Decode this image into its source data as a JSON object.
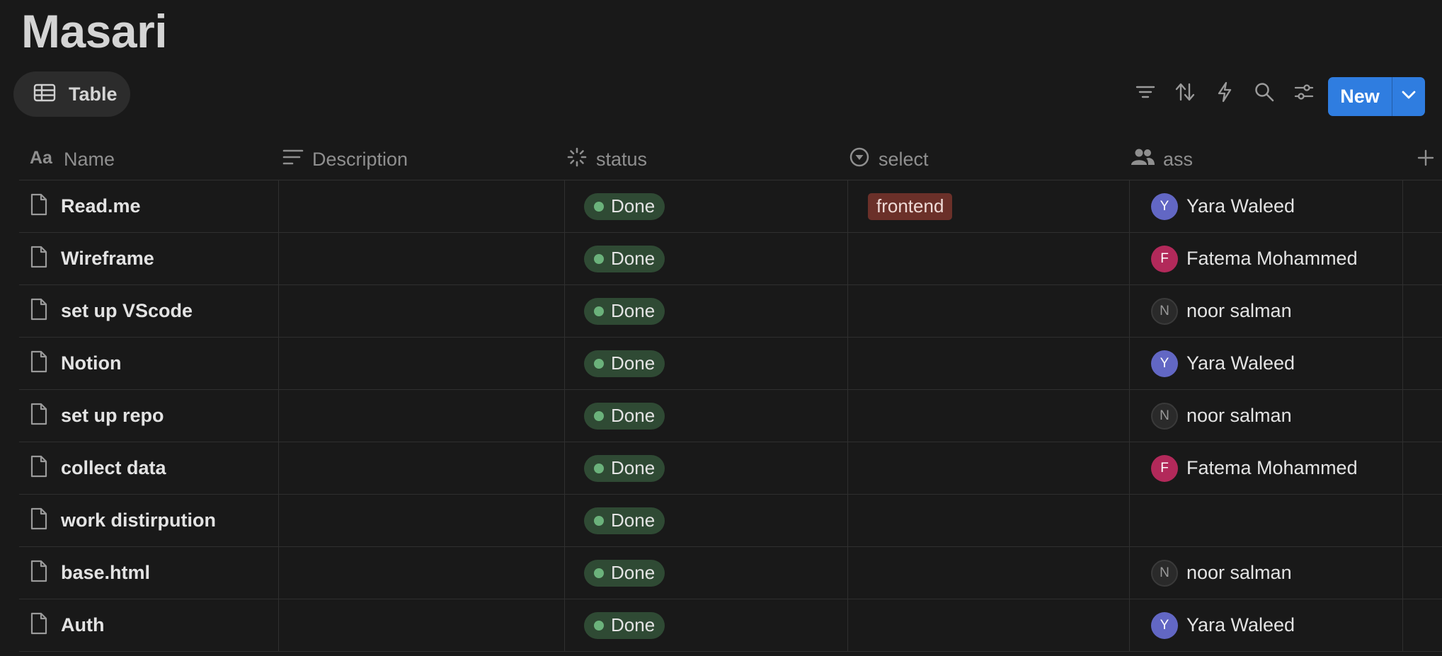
{
  "page": {
    "title": "Masari"
  },
  "view_tab": {
    "label": "Table",
    "icon": "table-icon"
  },
  "toolbar": {
    "icons": [
      "filter-icon",
      "sort-icon",
      "automation-icon",
      "search-icon",
      "settings-icon"
    ],
    "new_label": "New"
  },
  "columns": [
    {
      "label": "Name",
      "icon": "text-type-icon"
    },
    {
      "label": "Description",
      "icon": "text-lines-icon"
    },
    {
      "label": "status",
      "icon": "status-icon"
    },
    {
      "label": "select",
      "icon": "select-icon"
    },
    {
      "label": "ass",
      "icon": "people-icon"
    }
  ],
  "colors": {
    "background": "#191919",
    "accent": "#2f7de0",
    "status_done_bg": "#2f4a34",
    "status_done_dot": "#6bb27b",
    "tag_frontend_bg": "#6b3029"
  },
  "rows": [
    {
      "name": "Read.me",
      "description": "",
      "status": "Done",
      "select": "frontend",
      "assignee": {
        "initial": "Y",
        "name": "Yara Waleed",
        "color": "#6267c4"
      }
    },
    {
      "name": "Wireframe",
      "description": "",
      "status": "Done",
      "select": "",
      "assignee": {
        "initial": "F",
        "name": "Fatema Mohammed",
        "color": "#b2295a"
      }
    },
    {
      "name": "set up VScode",
      "description": "",
      "status": "Done",
      "select": "",
      "assignee": {
        "initial": "N",
        "name": "noor salman",
        "color": "#2a2a2a"
      }
    },
    {
      "name": "Notion",
      "description": "",
      "status": "Done",
      "select": "",
      "assignee": {
        "initial": "Y",
        "name": "Yara Waleed",
        "color": "#6267c4"
      }
    },
    {
      "name": "set up repo",
      "description": "",
      "status": "Done",
      "select": "",
      "assignee": {
        "initial": "N",
        "name": "noor salman",
        "color": "#2a2a2a"
      }
    },
    {
      "name": "collect data",
      "description": "",
      "status": "Done",
      "select": "",
      "assignee": {
        "initial": "F",
        "name": "Fatema Mohammed",
        "color": "#b2295a"
      }
    },
    {
      "name": "work distirpution",
      "description": "",
      "status": "Done",
      "select": "",
      "assignee": null
    },
    {
      "name": "base.html",
      "description": "",
      "status": "Done",
      "select": "",
      "assignee": {
        "initial": "N",
        "name": "noor salman",
        "color": "#2a2a2a"
      }
    },
    {
      "name": "Auth",
      "description": "",
      "status": "Done",
      "select": "",
      "assignee": {
        "initial": "Y",
        "name": "Yara Waleed",
        "color": "#6267c4"
      }
    }
  ]
}
